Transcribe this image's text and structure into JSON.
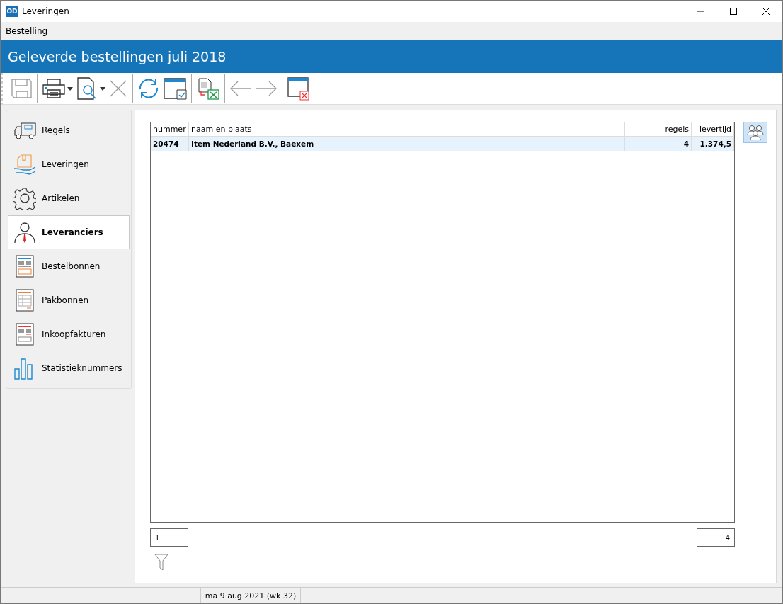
{
  "window": {
    "app_badge": "OD",
    "title": "Leveringen"
  },
  "menu": [
    "Bestelling"
  ],
  "header": {
    "title": "Geleverde bestellingen juli 2018"
  },
  "toolbar": [
    {
      "kind": "save",
      "disabled": true
    },
    {
      "kind": "sep"
    },
    {
      "kind": "print",
      "disabled": false
    },
    {
      "kind": "preview",
      "disabled": false
    },
    {
      "kind": "delete",
      "disabled": true
    },
    {
      "kind": "sep"
    },
    {
      "kind": "refresh",
      "disabled": false
    },
    {
      "kind": "select",
      "disabled": false
    },
    {
      "kind": "sep"
    },
    {
      "kind": "excel",
      "disabled": false
    },
    {
      "kind": "sep"
    },
    {
      "kind": "back",
      "disabled": true
    },
    {
      "kind": "forward",
      "disabled": true
    },
    {
      "kind": "sep"
    },
    {
      "kind": "close",
      "disabled": false
    }
  ],
  "sidebar": {
    "items": [
      {
        "label": "Regels",
        "kind": "truck",
        "selected": false
      },
      {
        "label": "Leveringen",
        "kind": "package",
        "selected": false
      },
      {
        "label": "Artikelen",
        "kind": "gear",
        "selected": false
      },
      {
        "label": "Leveranciers",
        "kind": "person",
        "selected": true
      },
      {
        "label": "Bestelbonnen",
        "kind": "order",
        "selected": false
      },
      {
        "label": "Pakbonnen",
        "kind": "packing",
        "selected": false
      },
      {
        "label": "Inkoopfakturen",
        "kind": "invoice",
        "selected": false
      },
      {
        "label": "Statistieknummers",
        "kind": "chart",
        "selected": false
      }
    ]
  },
  "table": {
    "columns": [
      {
        "label": "nummer",
        "kind": "text"
      },
      {
        "label": "naam en plaats",
        "kind": "text"
      },
      {
        "label": "regels",
        "kind": "number"
      },
      {
        "label": "levertijd",
        "kind": "number"
      }
    ],
    "rows": [
      {
        "cells": [
          "20474",
          "Item Nederland B.V., Baexem",
          "4",
          "1.374,5"
        ],
        "selected": true
      }
    ]
  },
  "footer": {
    "first_field": "1",
    "last_field": "4"
  },
  "status_bar": {
    "date": "ma 9 aug 2021 (wk 32)"
  }
}
